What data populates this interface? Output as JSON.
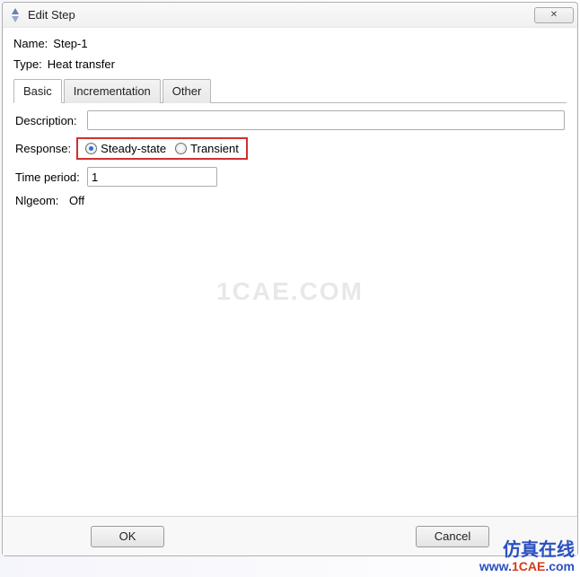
{
  "window": {
    "title": "Edit Step",
    "close_icon": "✕"
  },
  "fields": {
    "name_label": "Name:",
    "name_value": "Step-1",
    "type_label": "Type:",
    "type_value": "Heat transfer",
    "description_label": "Description:",
    "description_value": "",
    "response_label": "Response:",
    "time_period_label": "Time period:",
    "time_period_value": "1",
    "nlgeom_label": "Nlgeom:",
    "nlgeom_value": "Off"
  },
  "tabs": {
    "basic": "Basic",
    "incrementation": "Incrementation",
    "other": "Other"
  },
  "response": {
    "steady_label": "Steady-state",
    "transient_label": "Transient",
    "selected": "steady"
  },
  "buttons": {
    "ok": "OK",
    "cancel": "Cancel"
  },
  "watermark": "1CAE.COM",
  "branding": {
    "line1": "仿真在线",
    "url_a": "www.",
    "url_b": "1CAE",
    "url_c": ".com"
  }
}
